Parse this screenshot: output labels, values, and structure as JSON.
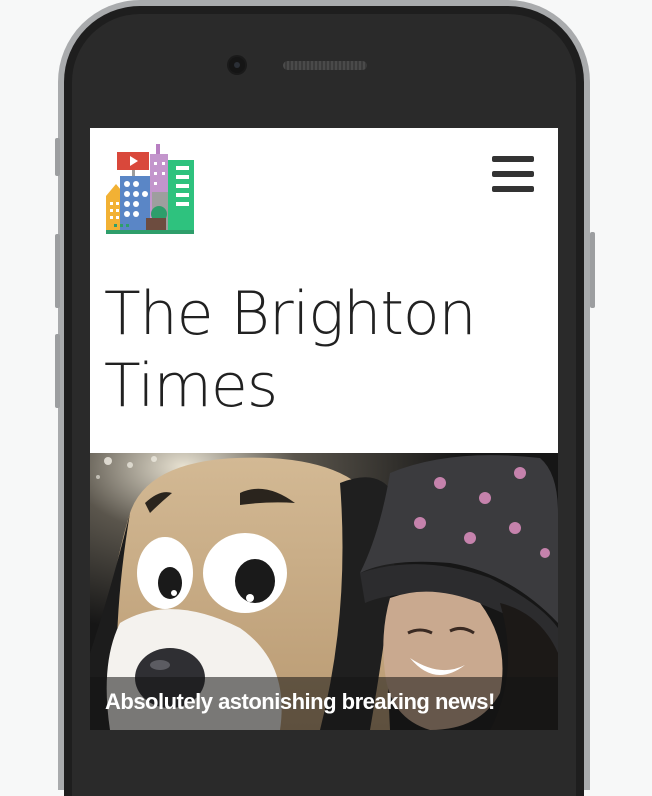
{
  "site": {
    "title": "The Brighton Times",
    "logo_icon": "city-buildings-logo-icon",
    "menu_icon": "hamburger-menu-icon"
  },
  "hero": {
    "caption": "Absolutely astonishing breaking news!",
    "image_description": "photo-mascot-and-woman"
  },
  "colors": {
    "page_bg": "#f7f8f8",
    "phone_frame": "#2a2a2a",
    "screen_bg": "#ffffff",
    "title_text": "#212121",
    "caption_text": "#ffffff"
  }
}
